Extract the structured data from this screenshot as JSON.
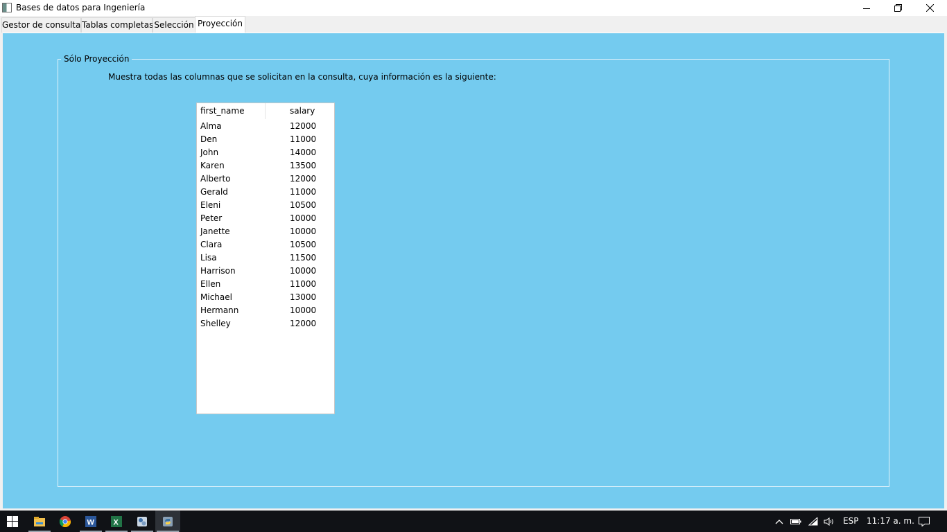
{
  "window": {
    "title": "Bases de datos para Ingeniería",
    "icons": {
      "minimize": "minimize-icon",
      "restore": "restore-icon",
      "close": "close-icon"
    }
  },
  "tabs": [
    {
      "label": "Gestor de consultas",
      "active": false
    },
    {
      "label": "Tablas completas",
      "active": false
    },
    {
      "label": "Selección",
      "active": false
    },
    {
      "label": "Proyección",
      "active": true
    }
  ],
  "panel": {
    "background": "#74cbef",
    "group_title": "Sólo Proyección",
    "description": "Muestra todas las columnas que se solicitan en la consulta, cuya información es la siguiente:"
  },
  "table": {
    "columns": [
      "first_name",
      "salary"
    ],
    "rows": [
      [
        "Alma",
        "12000"
      ],
      [
        "Den",
        "11000"
      ],
      [
        "John",
        "14000"
      ],
      [
        "Karen",
        "13500"
      ],
      [
        "Alberto",
        "12000"
      ],
      [
        "Gerald",
        "11000"
      ],
      [
        "Eleni",
        "10500"
      ],
      [
        "Peter",
        "10000"
      ],
      [
        "Janette",
        "10000"
      ],
      [
        "Clara",
        "10500"
      ],
      [
        "Lisa",
        "11500"
      ],
      [
        "Harrison",
        "10000"
      ],
      [
        "Ellen",
        "11000"
      ],
      [
        "Michael",
        "13000"
      ],
      [
        "Hermann",
        "10000"
      ],
      [
        "Shelley",
        "12000"
      ]
    ]
  },
  "taskbar": {
    "apps": [
      "windows-start-icon",
      "file-explorer-icon",
      "chrome-icon",
      "word-icon",
      "excel-icon",
      "app-icon",
      "python-icon"
    ],
    "language": "ESP",
    "time": "11:17 a. m."
  }
}
